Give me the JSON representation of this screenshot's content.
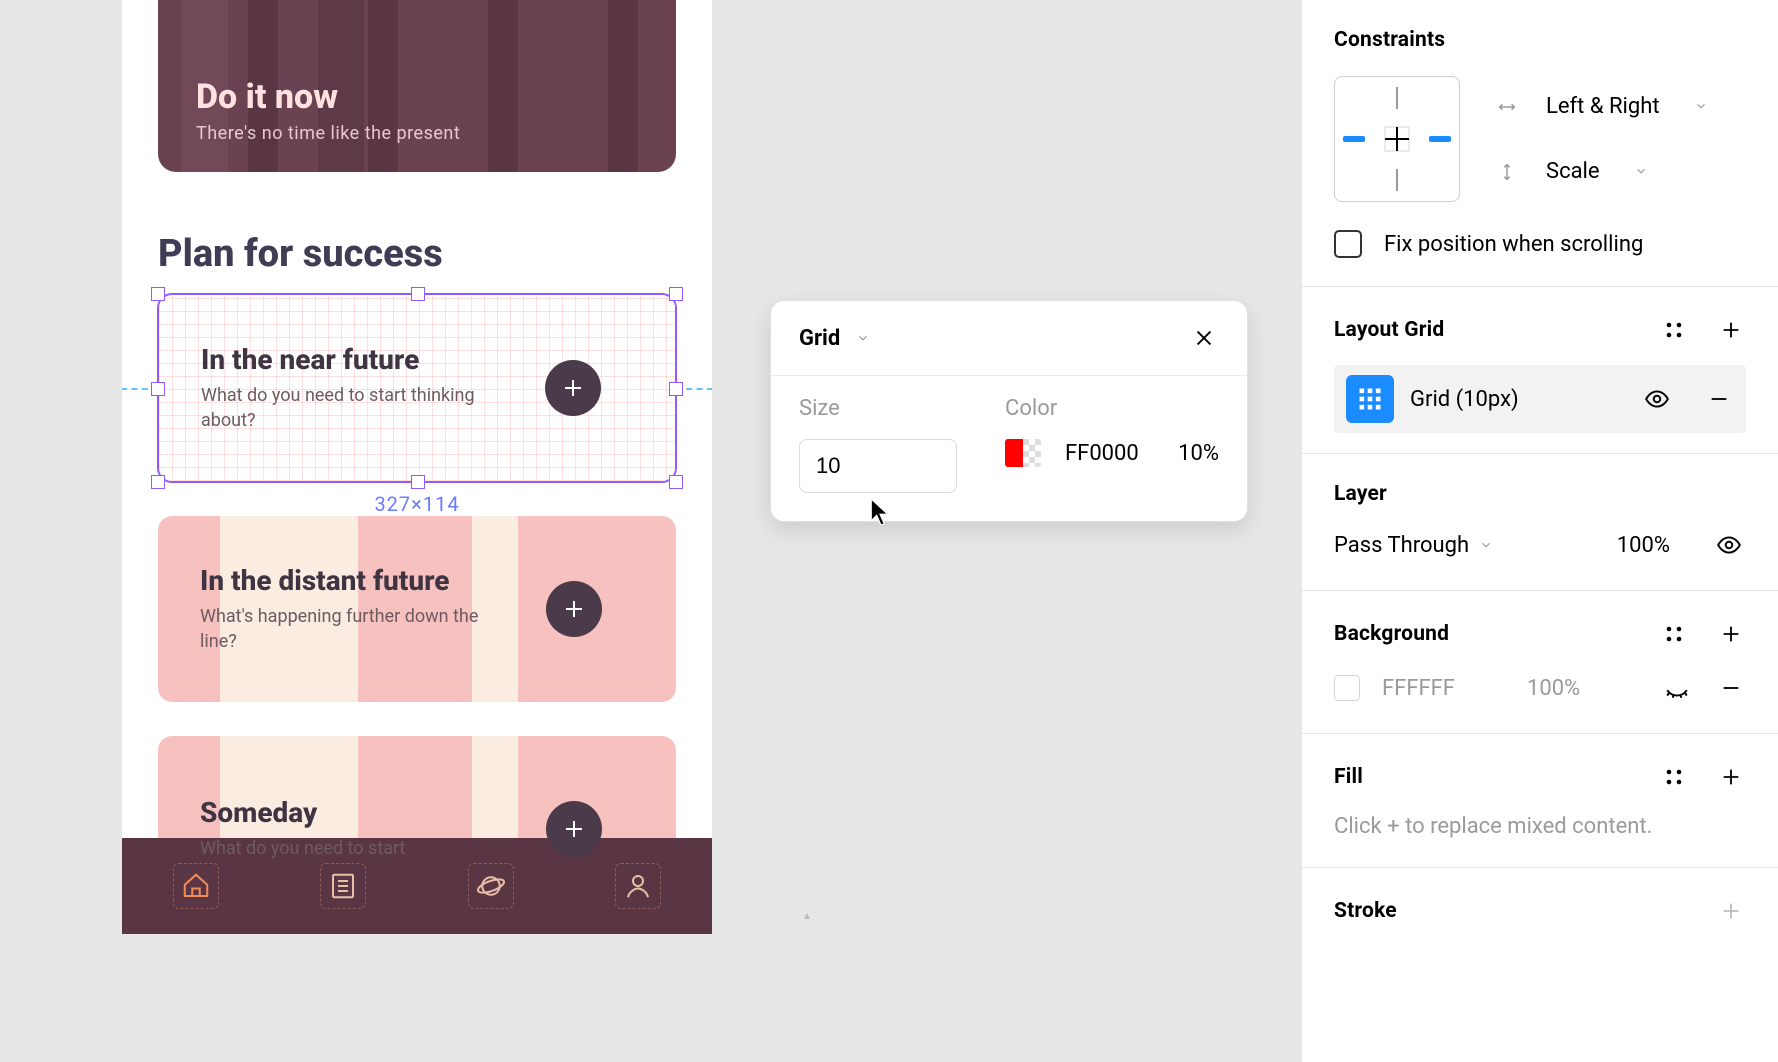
{
  "canvas": {
    "hero": {
      "title": "Do it now",
      "subtitle": "There's no time like the present"
    },
    "section_title": "Plan for success",
    "cards": [
      {
        "title": "In the near future",
        "subtitle": "What do you need to start thinking about?"
      },
      {
        "title": "In the distant future",
        "subtitle": "What's happening further down the line?"
      },
      {
        "title": "Someday",
        "subtitle": "What do you need to start"
      }
    ],
    "selection_size": "327×114"
  },
  "popover": {
    "title": "Grid",
    "size_label": "Size",
    "size_value": "10",
    "color_label": "Color",
    "color_hex": "FF0000",
    "color_opacity": "10%"
  },
  "panel": {
    "constraints": {
      "title": "Constraints",
      "horizontal": "Left & Right",
      "vertical": "Scale",
      "fix_label": "Fix position when scrolling"
    },
    "layout_grid": {
      "title": "Layout Grid",
      "row_label": "Grid (10px)"
    },
    "layer": {
      "title": "Layer",
      "blend_mode": "Pass Through",
      "opacity": "100%"
    },
    "background": {
      "title": "Background",
      "hex": "FFFFFF",
      "opacity": "100%"
    },
    "fill": {
      "title": "Fill",
      "placeholder": "Click + to replace mixed content."
    },
    "stroke": {
      "title": "Stroke"
    }
  }
}
